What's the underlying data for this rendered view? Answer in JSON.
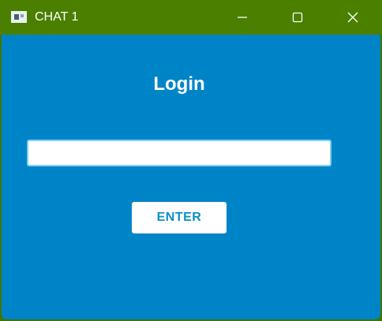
{
  "window": {
    "title": "CHAT 1",
    "controls": {
      "minimize_icon": "minimize-icon",
      "maximize_icon": "maximize-icon",
      "close_icon": "close-icon"
    },
    "app_icon": "window-app-icon"
  },
  "login": {
    "heading": "Login",
    "input_value": "",
    "enter_label": "ENTER"
  },
  "colors": {
    "titlebar": "#4a7f00",
    "background": "#0084c8",
    "button_text": "#0a91c6",
    "input_border": "#7fd0f2"
  }
}
